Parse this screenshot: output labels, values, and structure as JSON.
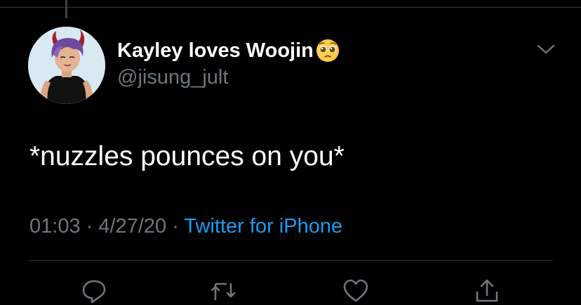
{
  "tweet": {
    "author": {
      "display_name": "Kayley loves Woojin",
      "name_emoji": "pleading-face-emoji",
      "handle": "@jisung_jult"
    },
    "text": "*nuzzles pounces on you*",
    "time": "01:03",
    "date": "4/27/20",
    "source": "Twitter for iPhone",
    "separator": "·"
  },
  "actions": {
    "icons": [
      "reply-icon",
      "retweet-icon",
      "like-icon",
      "share-icon"
    ]
  },
  "colors": {
    "background": "#000000",
    "primary_text": "#ffffff",
    "secondary_text": "#6e767d",
    "link": "#1d9bf0",
    "divider": "#2f3336"
  }
}
